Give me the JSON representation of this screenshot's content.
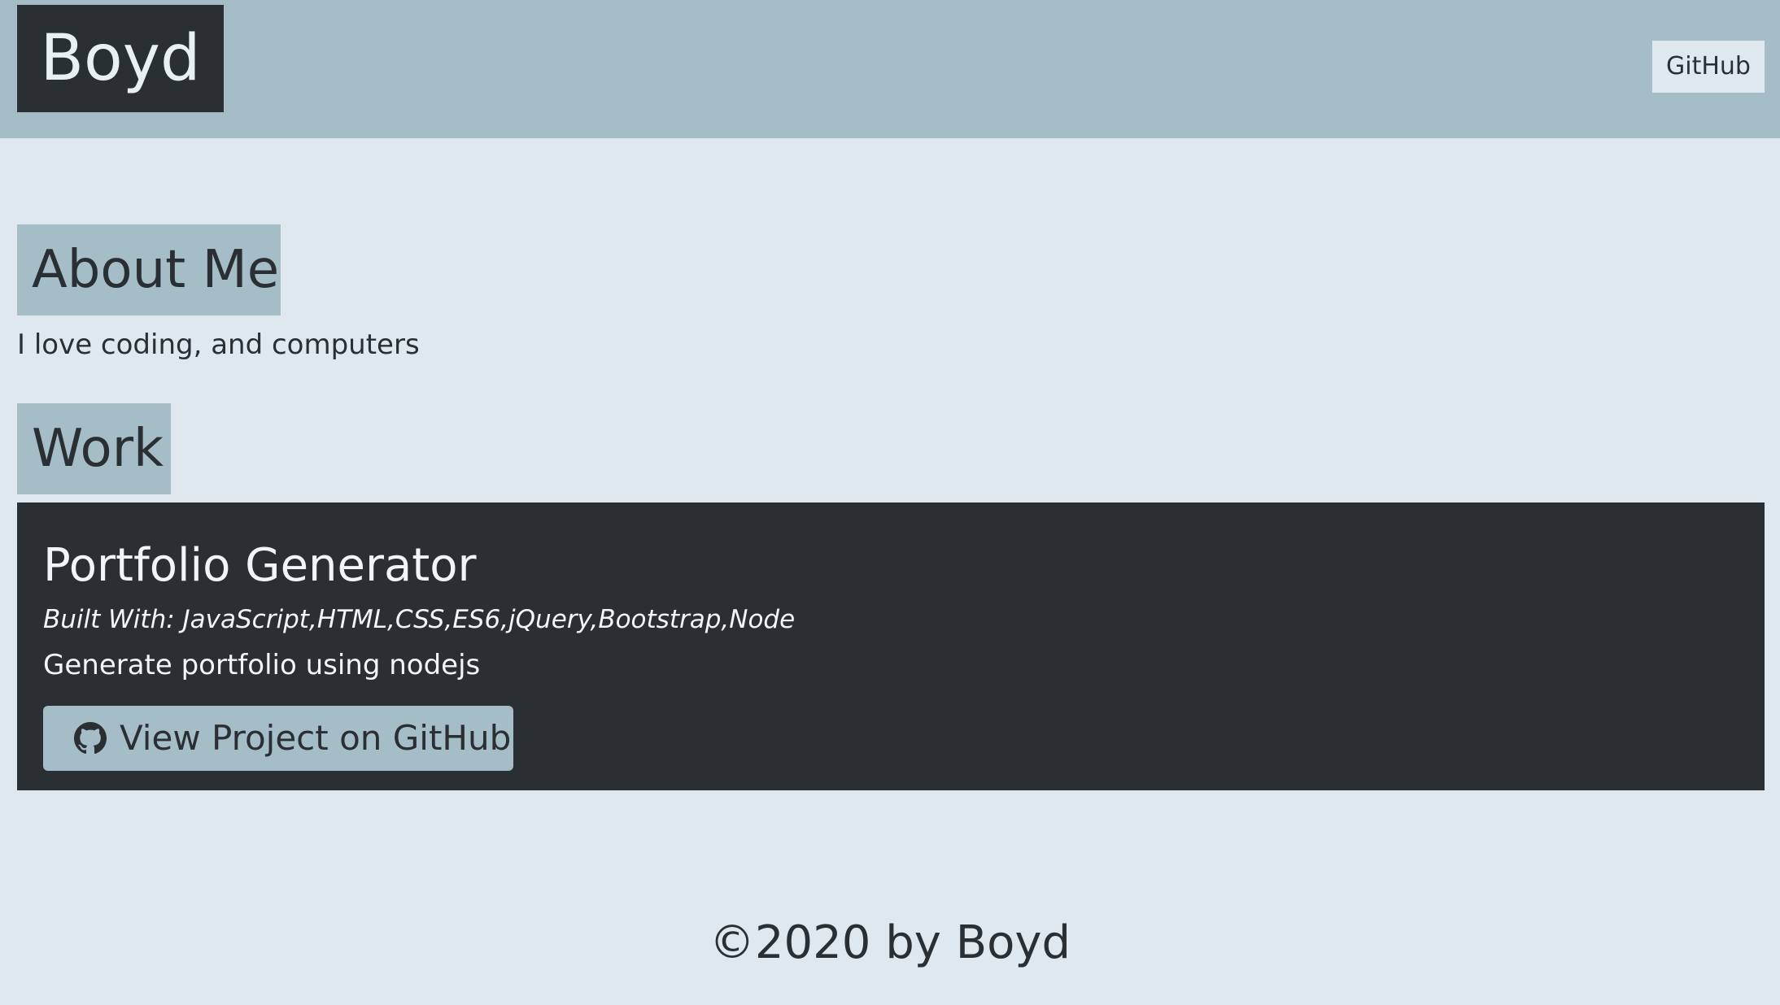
{
  "header": {
    "brand": "Boyd",
    "nav_link": "GitHub"
  },
  "about": {
    "heading": "About Me",
    "text": "I love coding, and computers"
  },
  "work": {
    "heading": "Work",
    "projects": [
      {
        "title": "Portfolio Generator",
        "built_with": "Built With: JavaScript,HTML,CSS,ES6,jQuery,Bootstrap,Node",
        "description": "Generate portfolio using nodejs",
        "button_label": "View Project on GitHub",
        "button_icon": "github-icon"
      }
    ]
  },
  "footer": {
    "text": "©2020 by Boyd"
  },
  "colors": {
    "page_bg": "#dee8ee",
    "accent": "#a5bdc6",
    "dark": "#2a2f33"
  }
}
